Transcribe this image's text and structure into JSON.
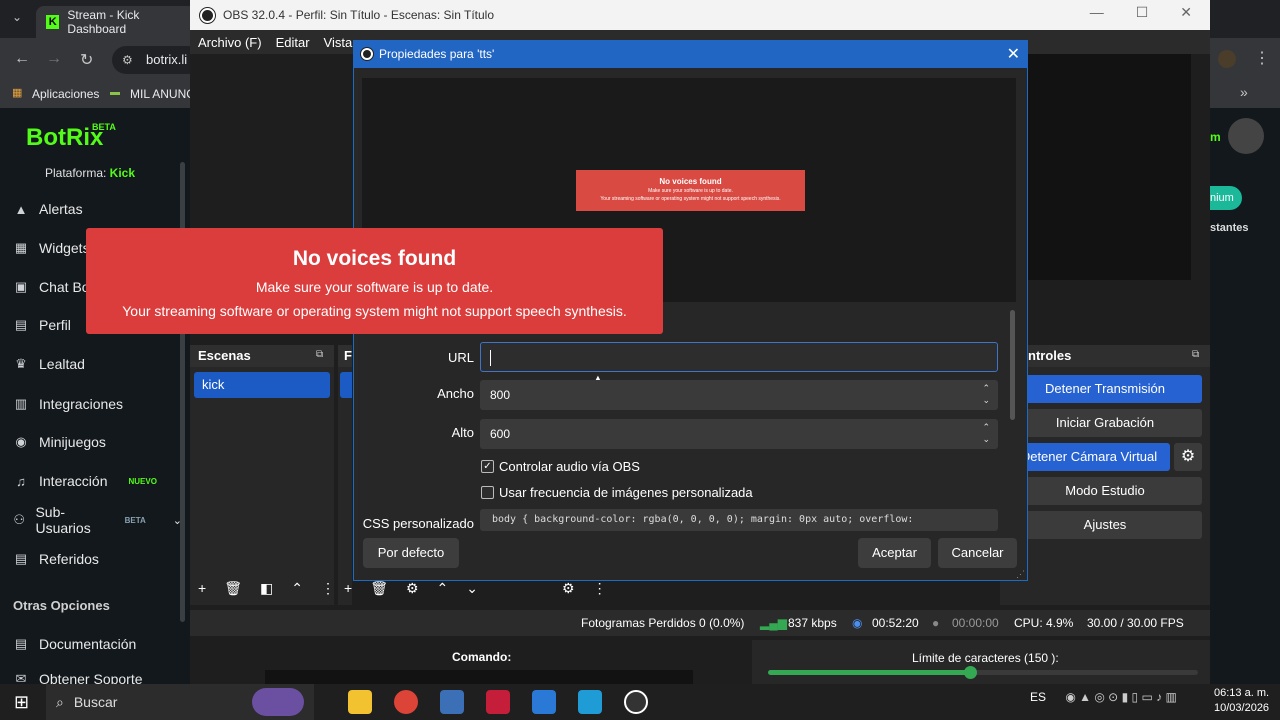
{
  "chrome": {
    "tab_title": "Stream - Kick Dashboard",
    "address": "botrix.li",
    "bookmarks": [
      "Aplicaciones",
      "MIL ANUNC"
    ]
  },
  "botrix": {
    "logo": "BotRix",
    "beta": "BETA",
    "platform_label": "Plataforma:",
    "platform_value": "Kick",
    "nav": [
      {
        "label": "Alertas",
        "icon": "warning-icon"
      },
      {
        "label": "Widgets",
        "icon": "widgets-icon"
      },
      {
        "label": "Chat Bo",
        "icon": "chatbot-icon"
      },
      {
        "label": "Perfil",
        "icon": "profile-icon"
      },
      {
        "label": "Lealtad",
        "icon": "trophy-icon"
      },
      {
        "label": "Integraciones",
        "icon": "integrations-icon"
      },
      {
        "label": "Minijuegos",
        "icon": "gamepad-icon"
      },
      {
        "label": "Interacción",
        "icon": "music-icon",
        "badge": "NUEVO"
      },
      {
        "label": "Sub-Usuarios",
        "icon": "users-icon",
        "badge": "BETA"
      },
      {
        "label": "Referidos",
        "icon": "referrals-icon"
      }
    ],
    "section": "Otras Opciones",
    "nav2": [
      {
        "label": "Documentación",
        "icon": "document-icon"
      },
      {
        "label": "Obtener Soporte",
        "icon": "support-icon"
      }
    ]
  },
  "right_strip": {
    "item1": "m",
    "item2": "nium",
    "item3": "stantes"
  },
  "obs": {
    "title": "OBS 32.0.4 - Perfil: Sin Título - Escenas: Sin Título",
    "menu": [
      "Archivo (F)",
      "Editar",
      "Vista"
    ],
    "scenes_title": "Escenas",
    "sources_title": "F",
    "scene_item": "kick",
    "controls_title": "ntroles",
    "controls": [
      "Detener Transmisión",
      "Iniciar Grabación",
      "Detener Cámara Virtual",
      "Modo Estudio",
      "Ajustes"
    ],
    "status": {
      "dropped": "Fotogramas Perdidos 0 (0.0%)",
      "bitrate": "837 kbps",
      "stream_time": "00:52:20",
      "rec_time": "00:00:00",
      "cpu": "CPU: 4.9%",
      "fps": "30.00 / 30.00 FPS"
    },
    "comando": "Comando:",
    "limite": "Límite de caracteres (150 ):",
    "limite_progress": 0.47
  },
  "dialog": {
    "title": "Propiedades para 'tts'",
    "url_label": "URL",
    "url_value": "",
    "ancho_label": "Ancho",
    "ancho_value": "800",
    "alto_label": "Alto",
    "alto_value": "600",
    "check1_label": "Controlar audio vía OBS",
    "check1_checked": true,
    "check2_label": "Usar frecuencia de imágenes personalizada",
    "check2_checked": false,
    "css_label": "CSS personalizado",
    "css_value": "body { background-color: rgba(0, 0, 0, 0); margin: 0px auto; overflow:",
    "default_btn": "Por defecto",
    "accept_btn": "Aceptar",
    "cancel_btn": "Cancelar",
    "preview_alert": {
      "title": "No voices found",
      "line1": "Make sure your software is up to date.",
      "line2": "Your streaming software or operating system might not support speech synthesis."
    }
  },
  "overlay_alert": {
    "title": "No voices found",
    "line1": "Make sure your software is up to date.",
    "line2": "Your streaming software or operating system might not support speech synthesis."
  },
  "taskbar": {
    "search": "Buscar",
    "lang": "ES",
    "time": "06:13 a. m.",
    "date": "10/03/2026"
  },
  "colors": {
    "kick_green": "#53fc18",
    "obs_blue": "#2662d1",
    "alert_red": "#db3d3d"
  }
}
